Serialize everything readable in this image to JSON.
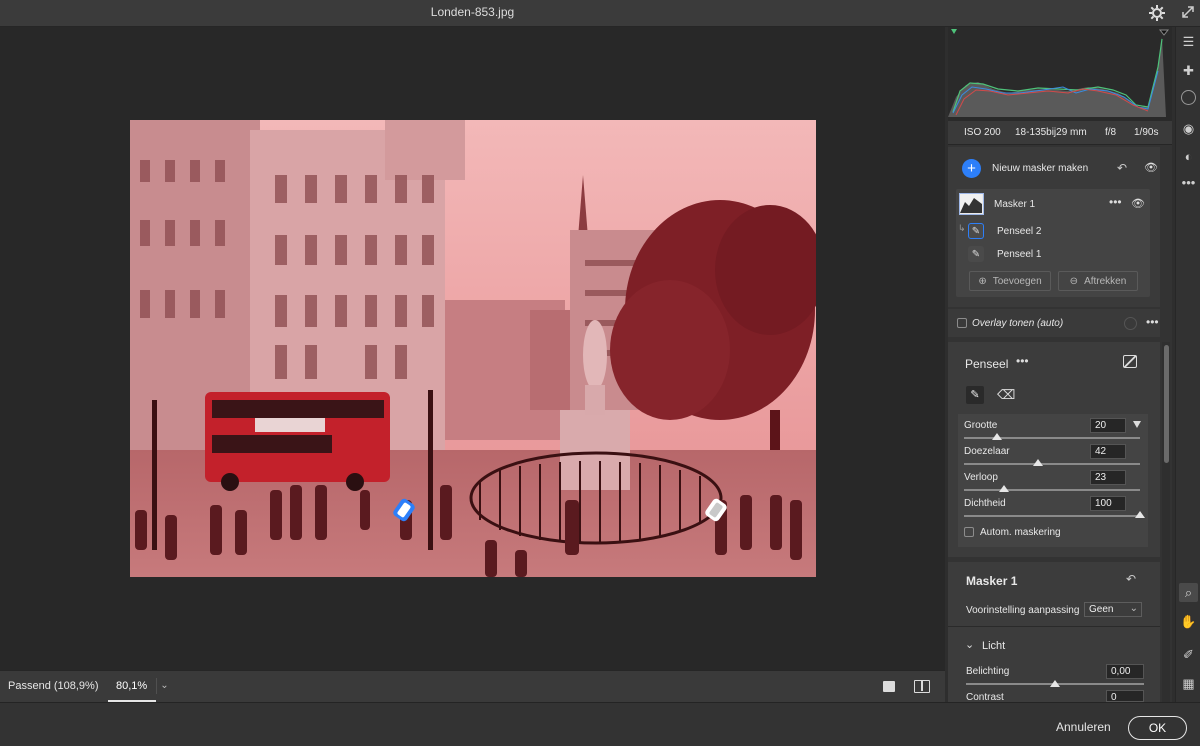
{
  "window": {
    "title": "Londen-853.jpg"
  },
  "histogram": {
    "iso": "ISO 200",
    "lens": "18-135bij29 mm",
    "aperture": "f/8",
    "shutter": "1/90s"
  },
  "masks": {
    "new_mask_label": "Nieuw masker maken",
    "mask_name": "Masker 1",
    "brush_items": [
      "Penseel 2",
      "Penseel 1"
    ],
    "add_label": "Toevoegen",
    "subtract_label": "Aftrekken",
    "overlay_label": "Overlay tonen (auto)"
  },
  "brush": {
    "title": "Penseel",
    "sliders": [
      {
        "label": "Grootte",
        "value": "20",
        "fraction": 0.19
      },
      {
        "label": "Doezelaar",
        "value": "42",
        "fraction": 0.42
      },
      {
        "label": "Verloop",
        "value": "23",
        "fraction": 0.23
      },
      {
        "label": "Dichtheid",
        "value": "100",
        "fraction": 1.0
      }
    ],
    "auto_mask_label": "Autom. maskering"
  },
  "mask_settings": {
    "title": "Masker 1",
    "preset_label": "Voorinstelling aanpassing",
    "preset_value": "Geen",
    "light_label": "Licht",
    "exposure_label": "Belichting",
    "exposure_value": "0,00",
    "exposure_fraction": 0.5,
    "contrast_label": "Contrast",
    "contrast_value": "0"
  },
  "zoom_bar": {
    "fit_label": "Passend (108,9%)",
    "zoom_value": "80,1%"
  },
  "footer": {
    "cancel_label": "Annuleren",
    "ok_label": "OK"
  },
  "colors": {
    "accent_blue": "#2d7ff9",
    "mask_overlay": "#e0474c",
    "histogram_green": "#4ec27a"
  }
}
